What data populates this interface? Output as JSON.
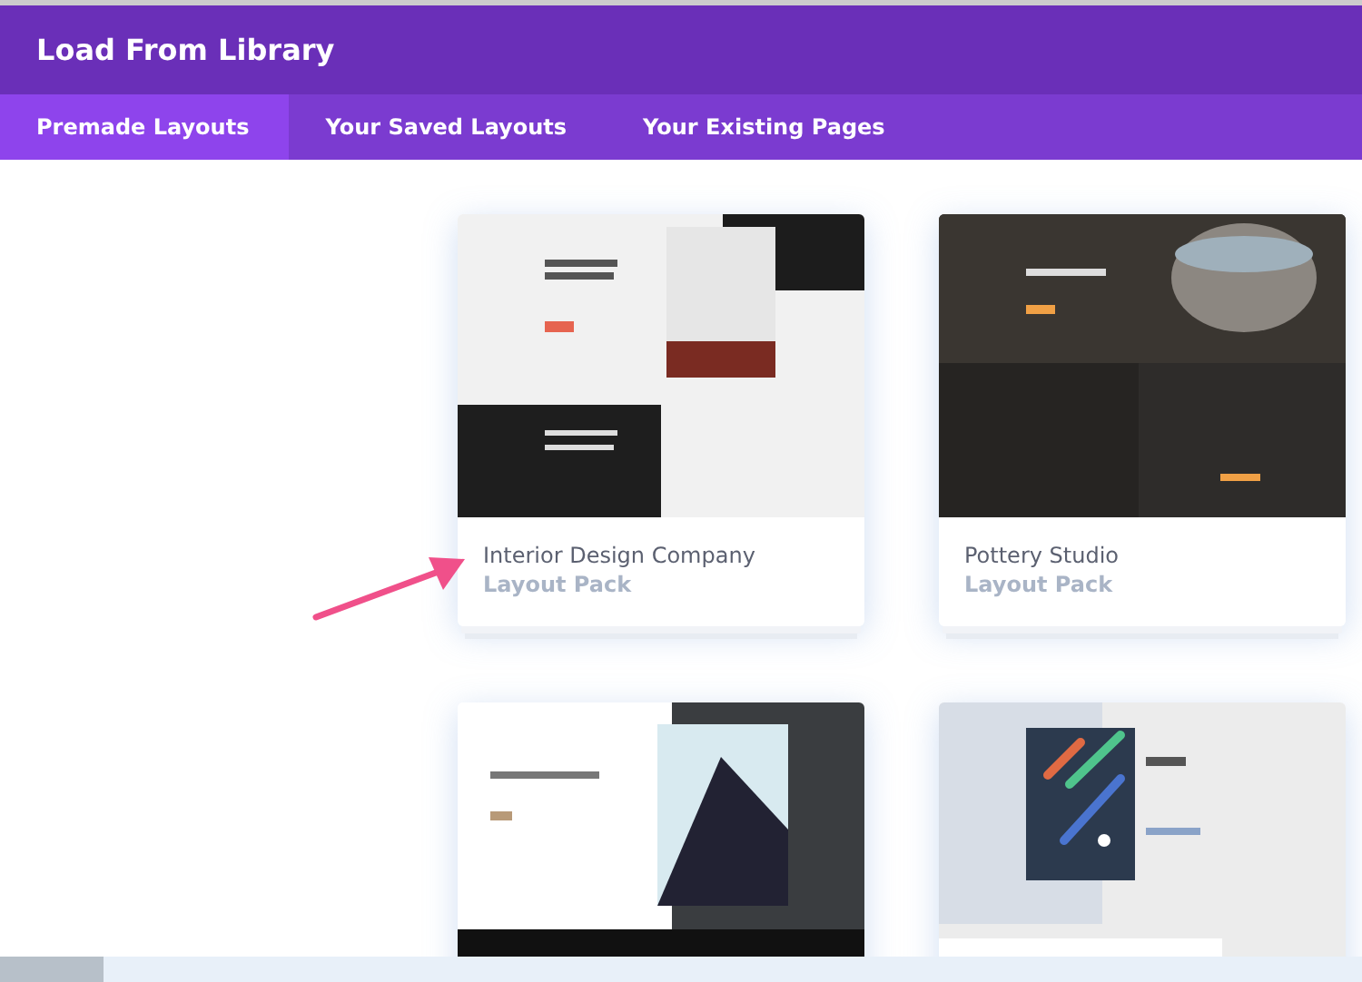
{
  "window": {
    "title": "Load From Library"
  },
  "tabs": [
    {
      "label": "Premade Layouts",
      "selected": true
    },
    {
      "label": "Your Saved Layouts",
      "selected": false
    },
    {
      "label": "Your Existing Pages",
      "selected": false
    }
  ],
  "layouts": [
    {
      "kind": "interior",
      "name": "Interior Design Company",
      "type": "Layout Pack"
    },
    {
      "kind": "pottery",
      "name": "Pottery Studio",
      "type": "Layout Pack"
    },
    {
      "kind": "architect"
    },
    {
      "kind": "rgb"
    }
  ]
}
